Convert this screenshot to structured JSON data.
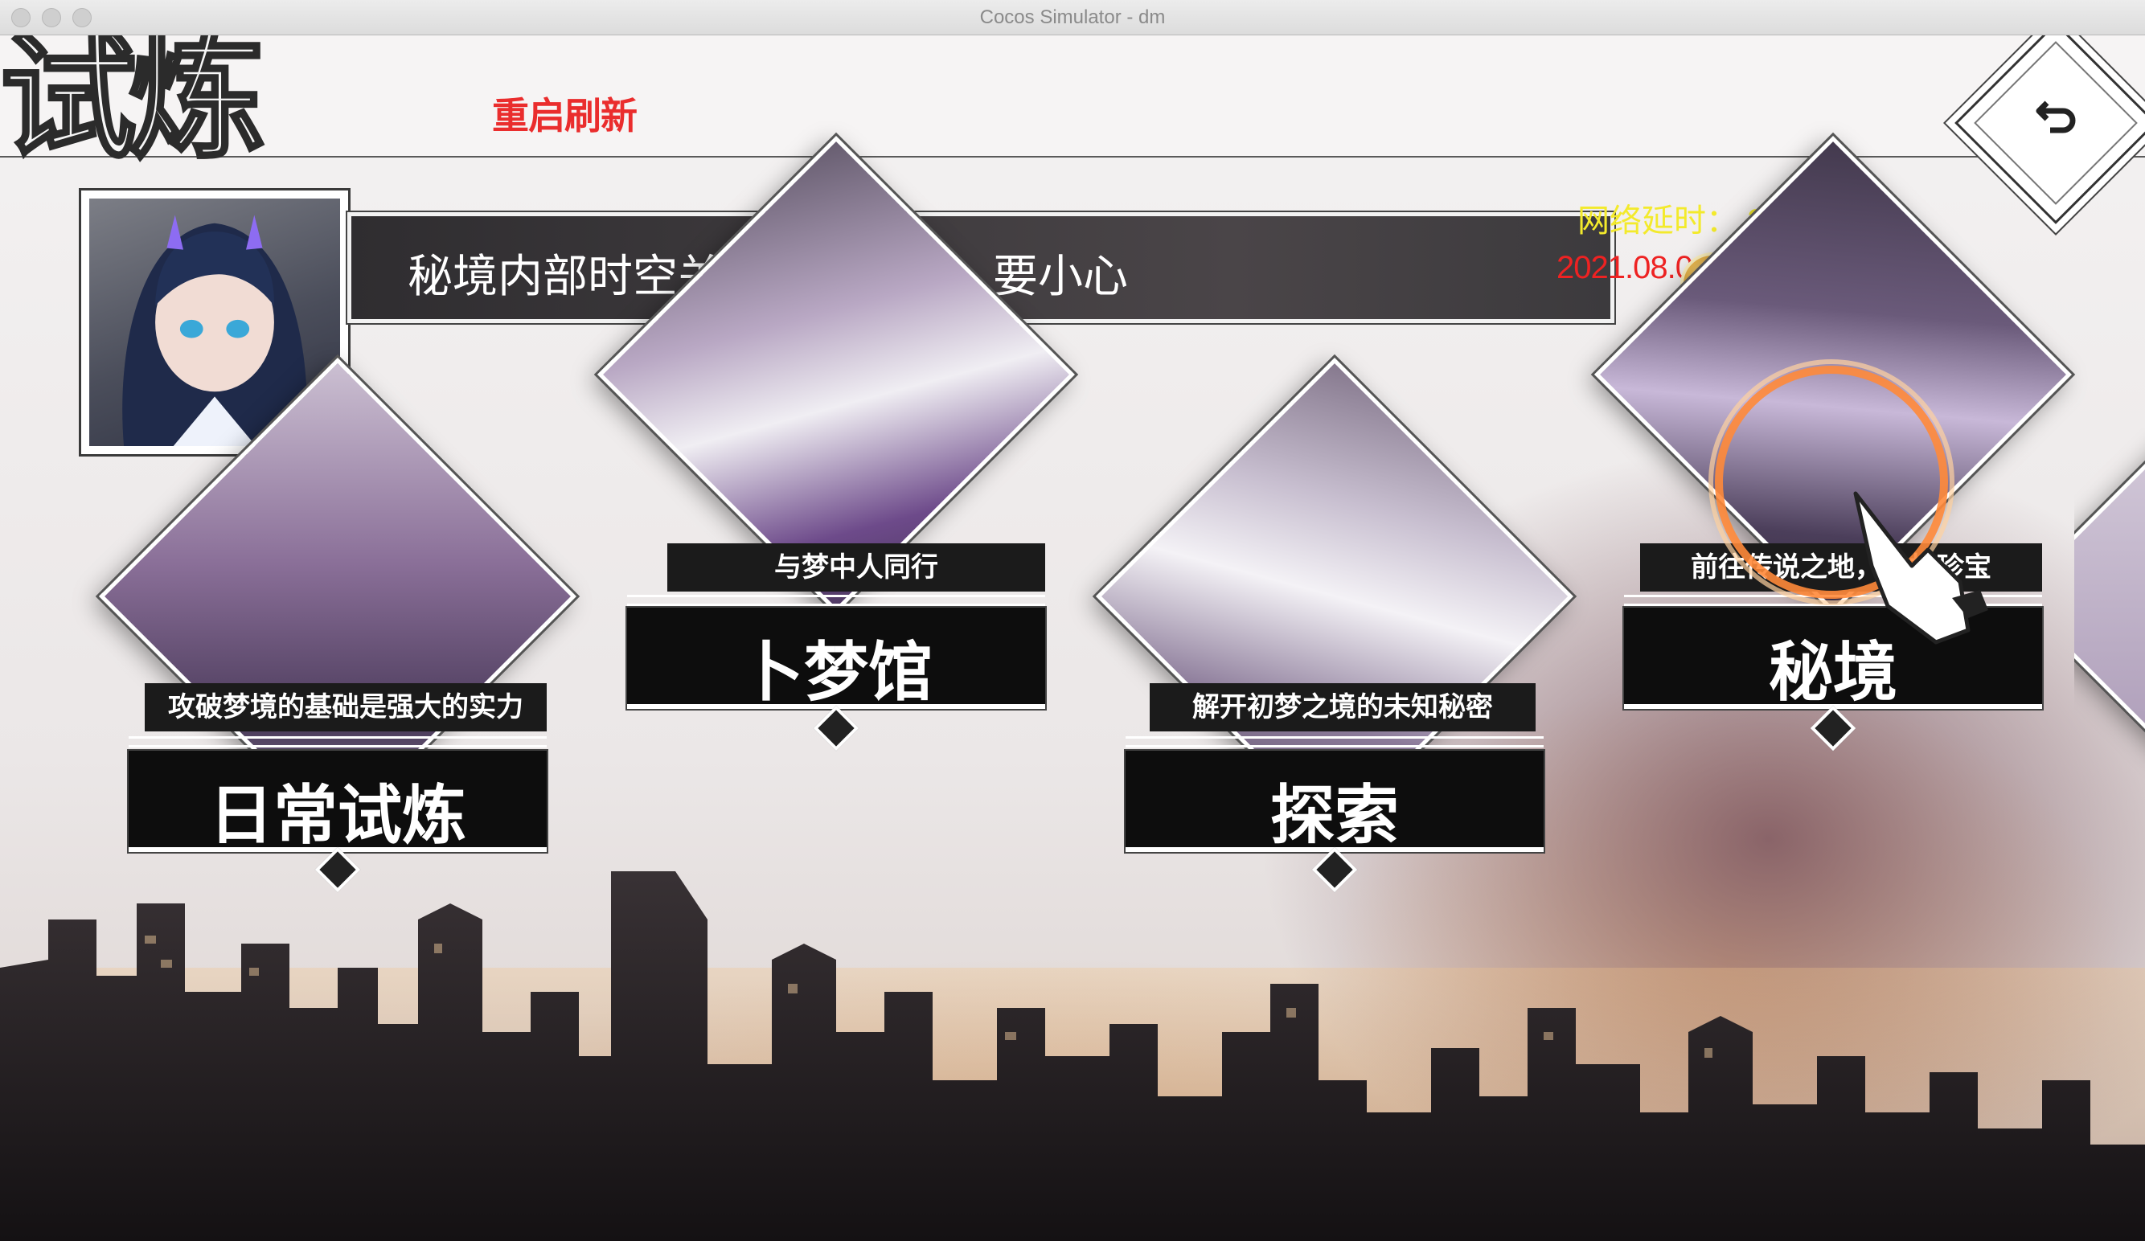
{
  "window": {
    "title": "Cocos Simulator - dm"
  },
  "header": {
    "title": "试炼",
    "refresh_label": "重启刷新"
  },
  "dialog": {
    "text": "秘境内部时空关系混乱不堪，要小心"
  },
  "status": {
    "latency": "网络延时： 20 ms",
    "datetime": "2021.08.04 12:36:46"
  },
  "colors": {
    "refresh": "#ea2d2d",
    "latency": "#f3ea2c",
    "clock": "#e22222"
  },
  "icons": {
    "back": "return-arrow-icon",
    "guide": "tap-hand-icon"
  },
  "cards": [
    {
      "subtitle": "攻破梦境的基础是强大的实力",
      "title": "日常试炼"
    },
    {
      "subtitle": "与梦中人同行",
      "title": "卜梦馆"
    },
    {
      "subtitle": "解开初梦之境的未知秘密",
      "title": "探索"
    },
    {
      "subtitle": "前往传说之地，寻找珍宝",
      "title": "秘境"
    }
  ]
}
